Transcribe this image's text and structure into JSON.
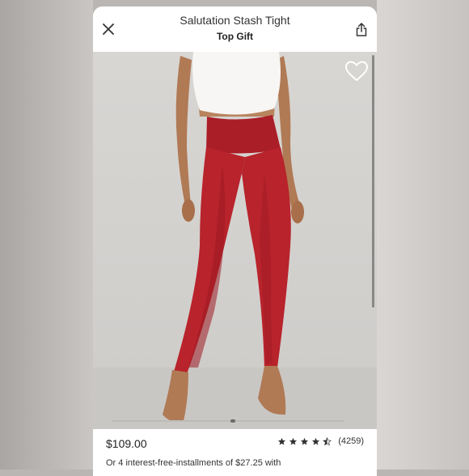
{
  "header": {
    "title": "Salutation Stash Tight",
    "subtitle": "Top Gift"
  },
  "icons": {
    "close": "close-icon",
    "share": "share-icon",
    "favorite": "heart-outline-icon",
    "star": "star-icon"
  },
  "product": {
    "price": "$109.00",
    "rating_value": 4.5,
    "review_count": "(4259)",
    "installments_text": "Or 4 interest-free-installments of $27.25 with",
    "colors": {
      "leggings": "#b8232c",
      "top": "#f7f6f4",
      "background": "#d6d4d1"
    }
  },
  "carousel": {
    "current_index": 1
  }
}
